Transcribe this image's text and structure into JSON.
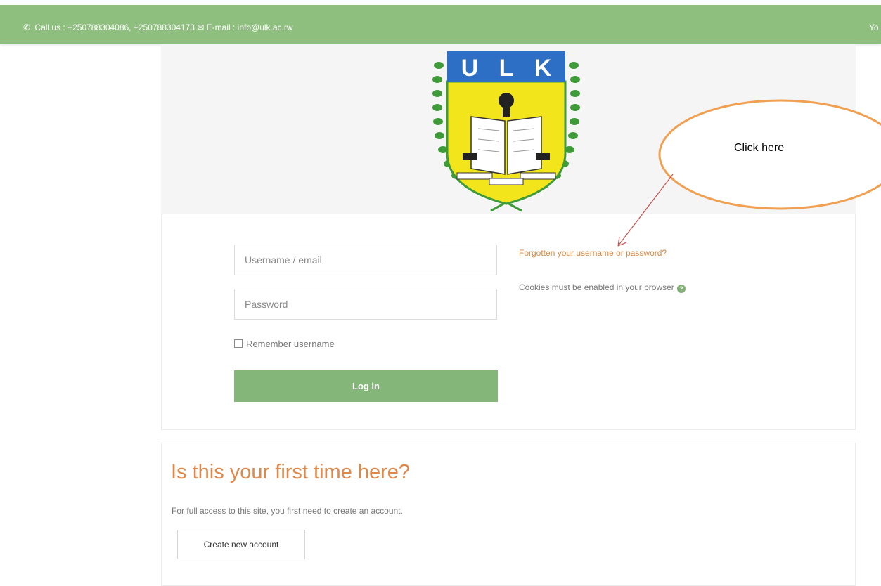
{
  "topbar": {
    "contact": "Call us : +250788304086, +250788304173 ✉ E-mail : info@ulk.ac.rw",
    "right_text": "Yo"
  },
  "logo": {
    "letters": [
      "U",
      "L",
      "K"
    ],
    "icon": "ulk-crest-logo",
    "colors": {
      "blue": "#2c6fc4",
      "yellow": "#f2e51c",
      "green": "#3f9a3a"
    }
  },
  "login": {
    "username_placeholder": "Username / email",
    "password_placeholder": "Password",
    "remember_label": "Remember username",
    "login_label": "Log in",
    "forgot_link": "Forgotten your username or password?",
    "cookies_text": "Cookies must be enabled in your browser",
    "help_icon": "?"
  },
  "first_time": {
    "title": "Is this your first time here?",
    "text": "For full access to this site, you first need to create an account.",
    "create_label": "Create new account"
  },
  "annotation": {
    "text": "Click here",
    "color": "#f0a050",
    "arrow_color": "#c0504d"
  },
  "colors": {
    "topbar": "#8fbf7f",
    "button": "#84b579",
    "accent_orange": "#e0884a"
  }
}
